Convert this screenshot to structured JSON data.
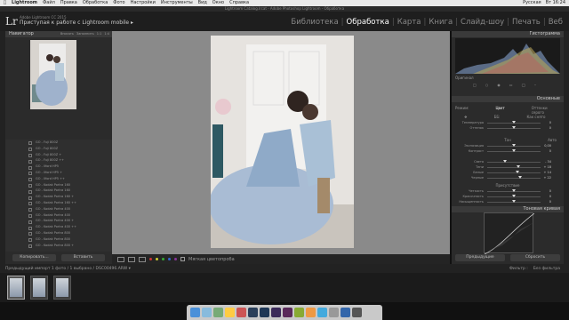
{
  "menubar": {
    "app": "Lightroom",
    "items": [
      "Файл",
      "Правка",
      "Обработка",
      "Фото",
      "Настройки",
      "Инструменты",
      "Вид",
      "Окно",
      "Справка"
    ],
    "status": [
      "Русская",
      "Вт 16:24"
    ]
  },
  "window_title": "Lightroom Catalog.lrcat - Adobe Photoshop Lightroom - Обработка",
  "identity": {
    "logo": "Lr",
    "line1": "Adobe Lightroom CC 2015",
    "line2": "Приступая к работе с Lightroom mobile ▸"
  },
  "modules": [
    "Библиотека",
    "Обработка",
    "Карта",
    "Книга",
    "Слайд-шоу",
    "Печать",
    "Веб"
  ],
  "active_module": "Обработка",
  "left": {
    "navigator": "Навигатор",
    "nav_opts": [
      "Вписать",
      "Заполнить",
      "1:1",
      "1:4"
    ],
    "presets": [
      "GO - Fuji 800Z",
      "GO - Fuji 800Z",
      "GO - Fuji 800Z +",
      "GO - Fuji 800Z ++",
      "GO - Ilford HP5",
      "GO - Ilford HP5 +",
      "GO - Ilford HP5 ++",
      "GO - Kodak Portra 160",
      "GO - Kodak Portra 160",
      "GO - Kodak Portra 160 +",
      "GO - Kodak Portra 160 ++",
      "GO - Kodak Portra 400",
      "GO - Kodak Portra 400",
      "GO - Kodak Portra 400 +",
      "GO - Kodak Portra 400 ++",
      "GO - Kodak Portra 800",
      "GO - Kodak Portra 800",
      "GO - Kodak Portra 800 +"
    ],
    "copy_btn": "Копировать...",
    "paste_btn": "Вставить"
  },
  "toolbar": {
    "label": "Мягкая цветопроба"
  },
  "right": {
    "histogram": "Гистограмма",
    "original": "Оригинал",
    "basic": "Основные",
    "treatment": "Режим:",
    "color": "Цвет",
    "bw": "Оттенки серого",
    "wb": "ББ:",
    "wb_val": "Как снято",
    "sliders": [
      {
        "label": "Температура",
        "val": "0",
        "pos": 0.5
      },
      {
        "label": "Оттенок",
        "val": "0",
        "pos": 0.5
      },
      {
        "label": "Экспозиция",
        "val": "0,00",
        "pos": 0.5
      },
      {
        "label": "Контраст",
        "val": "0",
        "pos": 0.5
      },
      {
        "label": "Света",
        "val": "- 34",
        "pos": 0.33
      },
      {
        "label": "Тени",
        "val": "+ 18",
        "pos": 0.59
      },
      {
        "label": "Белые",
        "val": "+ 14",
        "pos": 0.57
      },
      {
        "label": "Черные",
        "val": "+ 22",
        "pos": 0.61
      },
      {
        "label": "Четкость",
        "val": "0",
        "pos": 0.5
      },
      {
        "label": "Красочность",
        "val": "0",
        "pos": 0.5
      },
      {
        "label": "Насыщенность",
        "val": "0",
        "pos": 0.5
      }
    ],
    "tone": "Тон",
    "auto": "Авто",
    "presence": "Присутствие",
    "curve": "Тоновая кривая",
    "prev_btn": "Предыдущие",
    "reset_btn": "Сбросить"
  },
  "filmbar": {
    "text": "Предыдущий импорт  1 фото / 1 выбрано / DSC00496.ARW ▾",
    "filter": "Фильтр :",
    "filter_val": "Без фильтра"
  },
  "colors": {
    "accent": "#ffffff",
    "bg": "#2b2b2b"
  }
}
